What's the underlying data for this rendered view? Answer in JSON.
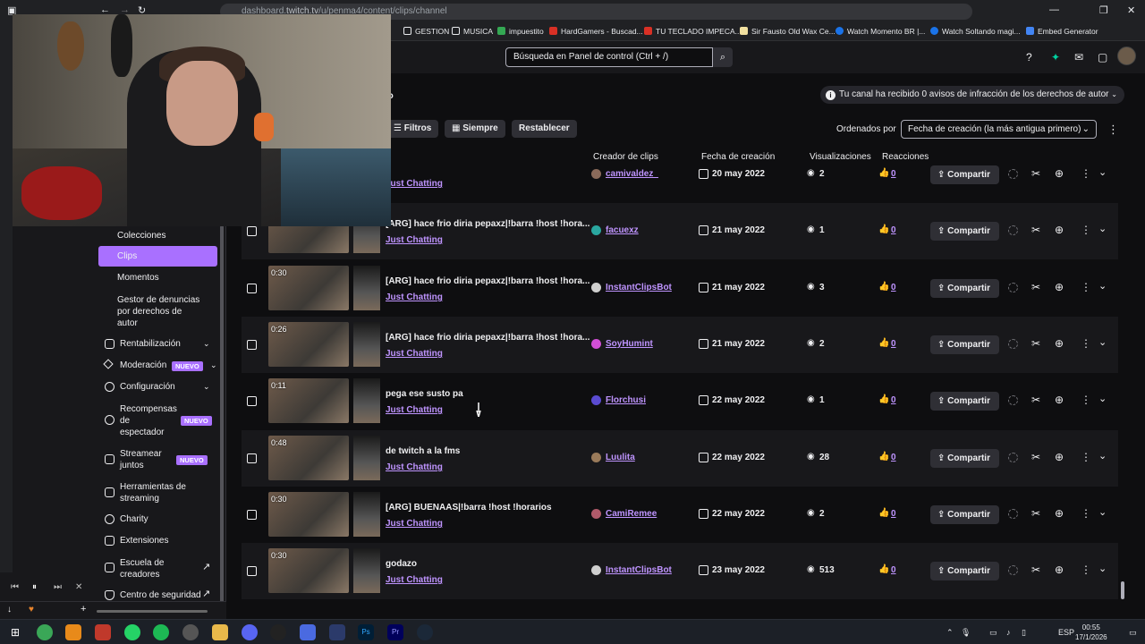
{
  "browser": {
    "url_prefix": "dashboard.",
    "url_domain": "twitch.tv",
    "url_path": "/u/penma4/content/clips/channel",
    "bookmarks": [
      {
        "label": "GESTION",
        "color": "#e8eaed"
      },
      {
        "label": "MUSICA",
        "color": "#e8eaed"
      },
      {
        "label": "impuestito",
        "color": "#34a853"
      },
      {
        "label": "HardGamers - Buscad...",
        "color": "#d93025"
      },
      {
        "label": "TU TECLADO IMPECA...",
        "color": "#d93025"
      },
      {
        "label": "Sir Fausto Old Wax Ce...",
        "color": "#f1e0a0"
      },
      {
        "label": "Watch Momento BR |...",
        "color": "#1a73e8"
      },
      {
        "label": "Watch Soltando magi...",
        "color": "#1a73e8"
      },
      {
        "label": "Embed Generator",
        "color": "#4285f4"
      }
    ]
  },
  "topnav": {
    "search_placeholder": "Búsqueda en Panel de control (Ctrl + /)"
  },
  "header": {
    "title_fragment": "ado",
    "notice": "Tu canal ha recibido 0 avisos de infracción de los derechos de autor",
    "filters_label": "Filtros",
    "period_label": "Siempre",
    "reset_label": "Restablecer",
    "sort_label": "Ordenados por",
    "sort_value": "Fecha de creación (la más antigua primero)"
  },
  "columns": {
    "creator": "Creador de clips",
    "created": "Fecha de creación",
    "views": "Visualizaciones",
    "reactions": "Reacciones"
  },
  "sidebar": {
    "items": [
      {
        "label": "Colecciones"
      },
      {
        "label": "Clips"
      },
      {
        "label": "Momentos"
      },
      {
        "label": "Gestor de denuncias por derechos de autor"
      },
      {
        "label": "Rentabilización"
      },
      {
        "label": "Moderación"
      },
      {
        "label": "Configuración"
      },
      {
        "label": "Recompensas de espectador"
      },
      {
        "label": "Streamear juntos"
      },
      {
        "label": "Herramientas de streaming"
      },
      {
        "label": "Charity"
      },
      {
        "label": "Extensiones"
      },
      {
        "label": "Escuela de creadores"
      },
      {
        "label": "Centro de seguridad"
      }
    ],
    "badge_new": "NUEVO",
    "copyright_lines": [
      "Gestor de denuncias",
      "por derechos de",
      "autor"
    ],
    "rewards_lines": [
      "Recompensas",
      "de",
      "espectador"
    ],
    "together_lines": [
      "Streamear",
      "juntos"
    ],
    "tools_lines": [
      "Herramientas de",
      "streaming"
    ],
    "school_lines": [
      "Escuela de",
      "creadores"
    ]
  },
  "share_label": "Compartir",
  "clips": [
    {
      "duration": "",
      "title": "",
      "category": "Just Chatting",
      "creator": "camivaldez_",
      "date": "20 may 2022",
      "views": "2",
      "reactions": "0",
      "avatar": "#8a6a5a"
    },
    {
      "duration": "",
      "title": "[ARG] hace frio diria pepaxz|!barra !host !hora...",
      "category": "Just Chatting",
      "creator": "facuexz",
      "date": "21 may 2022",
      "views": "1",
      "reactions": "0",
      "avatar": "#2aa7a0"
    },
    {
      "duration": "0:30",
      "title": "[ARG] hace frio diria pepaxz|!barra !host !hora...",
      "category": "Just Chatting",
      "creator": "InstantClipsBot",
      "date": "21 may 2022",
      "views": "3",
      "reactions": "0",
      "avatar": "#cfcfcf"
    },
    {
      "duration": "0:26",
      "title": "[ARG] hace frio diria pepaxz|!barra !host !hora...",
      "category": "Just Chatting",
      "creator": "SoyHumint",
      "date": "21 may 2022",
      "views": "2",
      "reactions": "0",
      "avatar": "#d24fd6"
    },
    {
      "duration": "0:11",
      "title": "pega ese susto pa",
      "category": "Just Chatting",
      "creator": "Florchusi",
      "date": "22 may 2022",
      "views": "1",
      "reactions": "0",
      "avatar": "#5a4bd1"
    },
    {
      "duration": "0:48",
      "title": "de twitch a la fms",
      "category": "Just Chatting",
      "creator": "Luulita",
      "date": "22 may 2022",
      "views": "28",
      "reactions": "0",
      "avatar": "#9a7a5a"
    },
    {
      "duration": "0:30",
      "title": "[ARG] BUENAAS|!barra !host !horarios",
      "category": "Just Chatting",
      "creator": "CamiRemee",
      "date": "22 may 2022",
      "views": "2",
      "reactions": "0",
      "avatar": "#b05a6a"
    },
    {
      "duration": "0:30",
      "title": "godazo",
      "category": "Just Chatting",
      "creator": "InstantClipsBot",
      "date": "23 may 2022",
      "views": "513",
      "reactions": "0",
      "avatar": "#cfcfcf"
    }
  ],
  "taskbar": {
    "lang": "ESP",
    "time": "00:55",
    "date": "17/1/2026"
  },
  "colors": {
    "accent": "#a970ff",
    "link": "#bf94ff",
    "background": "#0e0e10",
    "panel": "#18181b"
  }
}
